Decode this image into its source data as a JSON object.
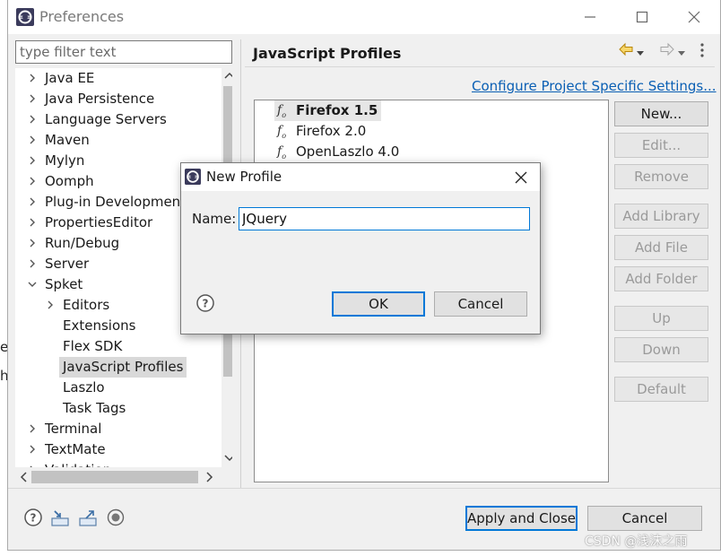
{
  "window": {
    "title": "Preferences"
  },
  "filter": {
    "placeholder": "type filter text"
  },
  "tree": {
    "items": [
      {
        "label": "Java EE",
        "level": 0,
        "expandable": true
      },
      {
        "label": "Java Persistence",
        "level": 0,
        "expandable": true
      },
      {
        "label": "Language Servers",
        "level": 0,
        "expandable": true
      },
      {
        "label": "Maven",
        "level": 0,
        "expandable": true
      },
      {
        "label": "Mylyn",
        "level": 0,
        "expandable": true
      },
      {
        "label": "Oomph",
        "level": 0,
        "expandable": true
      },
      {
        "label": "Plug-in Development",
        "level": 0,
        "expandable": true
      },
      {
        "label": "PropertiesEditor",
        "level": 0,
        "expandable": true
      },
      {
        "label": "Run/Debug",
        "level": 0,
        "expandable": true
      },
      {
        "label": "Server",
        "level": 0,
        "expandable": true
      },
      {
        "label": "Spket",
        "level": 0,
        "expandable": true,
        "expanded": true
      },
      {
        "label": "Editors",
        "level": 1,
        "expandable": true
      },
      {
        "label": "Extensions",
        "level": 1,
        "expandable": false
      },
      {
        "label": "Flex SDK",
        "level": 1,
        "expandable": false
      },
      {
        "label": "JavaScript Profiles",
        "level": 1,
        "expandable": false,
        "selected": true
      },
      {
        "label": "Laszlo",
        "level": 1,
        "expandable": false
      },
      {
        "label": "Task Tags",
        "level": 1,
        "expandable": false
      },
      {
        "label": "Terminal",
        "level": 0,
        "expandable": true
      },
      {
        "label": "TextMate",
        "level": 0,
        "expandable": true
      },
      {
        "label": "Validation",
        "level": 0,
        "expandable": true
      }
    ]
  },
  "panel": {
    "title": "JavaScript Profiles",
    "configure_link": "Configure Project Specific Settings...",
    "profiles": [
      {
        "label": "Firefox 1.5",
        "selected": true
      },
      {
        "label": "Firefox 2.0",
        "selected": false
      },
      {
        "label": "OpenLaszlo 4.0",
        "selected": false
      }
    ],
    "buttons": [
      {
        "label": "New...",
        "enabled": true
      },
      {
        "label": "Edit...",
        "enabled": false
      },
      {
        "label": "Remove",
        "enabled": false
      },
      {
        "label": "Add Library",
        "enabled": false
      },
      {
        "label": "Add File",
        "enabled": false
      },
      {
        "label": "Add Folder",
        "enabled": false
      },
      {
        "label": "Up",
        "enabled": false
      },
      {
        "label": "Down",
        "enabled": false
      },
      {
        "label": "Default",
        "enabled": false
      }
    ]
  },
  "footer": {
    "apply_close": "Apply and Close",
    "cancel": "Cancel"
  },
  "dialog": {
    "title": "New Profile",
    "name_label": "Name:",
    "name_value": "JQuery",
    "ok": "OK",
    "cancel": "Cancel"
  },
  "watermark": "CSDN @浅沫之雨",
  "colors": {
    "accent": "#0078d7",
    "link": "#0a5fb4"
  }
}
